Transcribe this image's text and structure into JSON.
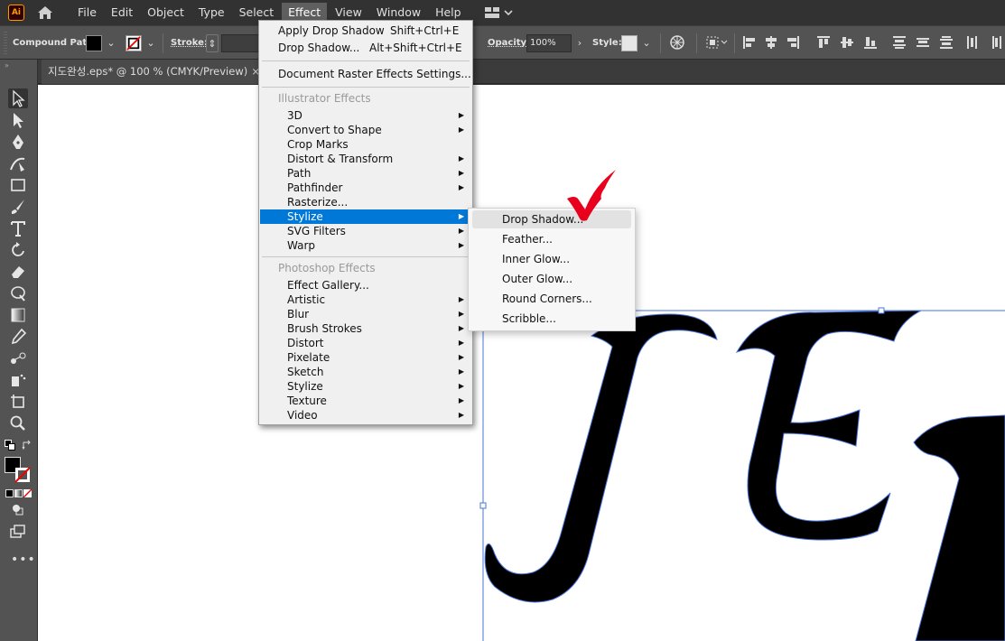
{
  "app": {
    "logo": "Ai"
  },
  "menubar": {
    "items": [
      "File",
      "Edit",
      "Object",
      "Type",
      "Select",
      "Effect",
      "View",
      "Window",
      "Help"
    ],
    "active": "Effect"
  },
  "controlbar": {
    "object_type": "Compound Path",
    "stroke_label": "Stroke:",
    "opacity_label": "Opacity:",
    "opacity_value": "100%",
    "style_label": "Style:"
  },
  "document_tab": {
    "title": "지도완성.eps* @ 100 % (CMYK/Preview)",
    "close": "×"
  },
  "effect_menu": {
    "apply_last": {
      "label": "Apply Drop Shadow",
      "shortcut": "Shift+Ctrl+E"
    },
    "last_effect": {
      "label": "Drop Shadow...",
      "shortcut": "Alt+Shift+Ctrl+E"
    },
    "doc_raster": "Document Raster Effects Settings...",
    "illustrator_header": "Illustrator Effects",
    "illustrator_items": [
      "3D",
      "Convert to Shape",
      "Crop Marks",
      "Distort & Transform",
      "Path",
      "Pathfinder",
      "Rasterize...",
      "Stylize",
      "SVG Filters",
      "Warp"
    ],
    "illustrator_has_sub": [
      true,
      true,
      false,
      true,
      true,
      true,
      false,
      true,
      true,
      true
    ],
    "highlighted": "Stylize",
    "photoshop_header": "Photoshop Effects",
    "photoshop_items": [
      "Effect Gallery...",
      "Artistic",
      "Blur",
      "Brush Strokes",
      "Distort",
      "Pixelate",
      "Sketch",
      "Stylize",
      "Texture",
      "Video"
    ],
    "photoshop_has_sub": [
      false,
      true,
      true,
      true,
      true,
      true,
      true,
      true,
      true,
      true
    ]
  },
  "stylize_submenu": {
    "items": [
      "Drop Shadow...",
      "Feather...",
      "Inner Glow...",
      "Outer Glow...",
      "Round Corners...",
      "Scribble..."
    ],
    "hovered": "Drop Shadow..."
  },
  "colors": {
    "accent_highlight": "#0078d7",
    "checkmark": "#e8001c",
    "selection": "#4a74d8"
  }
}
